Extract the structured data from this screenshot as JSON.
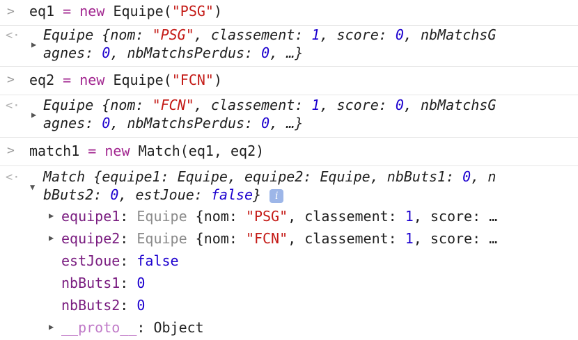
{
  "entries": [
    {
      "input": {
        "var": "eq1",
        "op": "=",
        "kw": "new",
        "cls": "Equipe",
        "open": "(",
        "arg": "\"PSG\"",
        "close": ")"
      },
      "output": {
        "l1": {
          "cls": "Equipe",
          "open": " {",
          "k1": "nom",
          "s1": "\"PSG\"",
          "k2": "classement",
          "v2": "1",
          "k3": "score",
          "v3": "0",
          "k4": "nbMatchsG"
        },
        "l2": {
          "k4b": "agnes",
          "v4": "0",
          "k5": "nbMatchsPerdus",
          "v5": "0",
          "tail": "…}"
        }
      }
    },
    {
      "input": {
        "var": "eq2",
        "op": "=",
        "kw": "new",
        "cls": "Equipe",
        "open": "(",
        "arg": "\"FCN\"",
        "close": ")"
      },
      "output": {
        "l1": {
          "cls": "Equipe",
          "open": " {",
          "k1": "nom",
          "s1": "\"FCN\"",
          "k2": "classement",
          "v2": "1",
          "k3": "score",
          "v3": "0",
          "k4": "nbMatchsG"
        },
        "l2": {
          "k4b": "agnes",
          "v4": "0",
          "k5": "nbMatchsPerdus",
          "v5": "0",
          "tail": "…}"
        }
      }
    }
  ],
  "match": {
    "input": {
      "var": "match1",
      "op": "=",
      "kw": "new",
      "call": "Match(eq1, eq2)"
    },
    "summary1": {
      "cls": "Match",
      "open": " {",
      "k1": "equipe1",
      "t1": "Equipe",
      "k2": "equipe2",
      "t2": "Equipe",
      "k3": "nbButs1",
      "v3": "0",
      "k4a": "n"
    },
    "summary2": {
      "k4b": "bButs2",
      "v4": "0",
      "k5": "estJoue",
      "v5": "false",
      "close": "}",
      "info": "i"
    },
    "props": [
      {
        "key": "equipe1",
        "type": "Equipe",
        "rest": " {nom: ",
        "str": "\"PSG\"",
        "rest2": ", classement: ",
        "num": "1",
        "rest3": ", score: …"
      },
      {
        "key": "equipe2",
        "type": "Equipe",
        "rest": " {nom: ",
        "str": "\"FCN\"",
        "rest2": ", classement: ",
        "num": "1",
        "rest3": ", score: …"
      }
    ],
    "estJoue": {
      "key": "estJoue",
      "value": "false"
    },
    "nbButs1": {
      "key": "nbButs1",
      "value": "0"
    },
    "nbButs2": {
      "key": "nbButs2",
      "value": "0"
    },
    "proto": {
      "key": "__proto__",
      "value": "Object"
    }
  },
  "glyphs": {
    "prompt": ">",
    "return": "<·",
    "collapsed": "▶",
    "expanded": "▼"
  }
}
